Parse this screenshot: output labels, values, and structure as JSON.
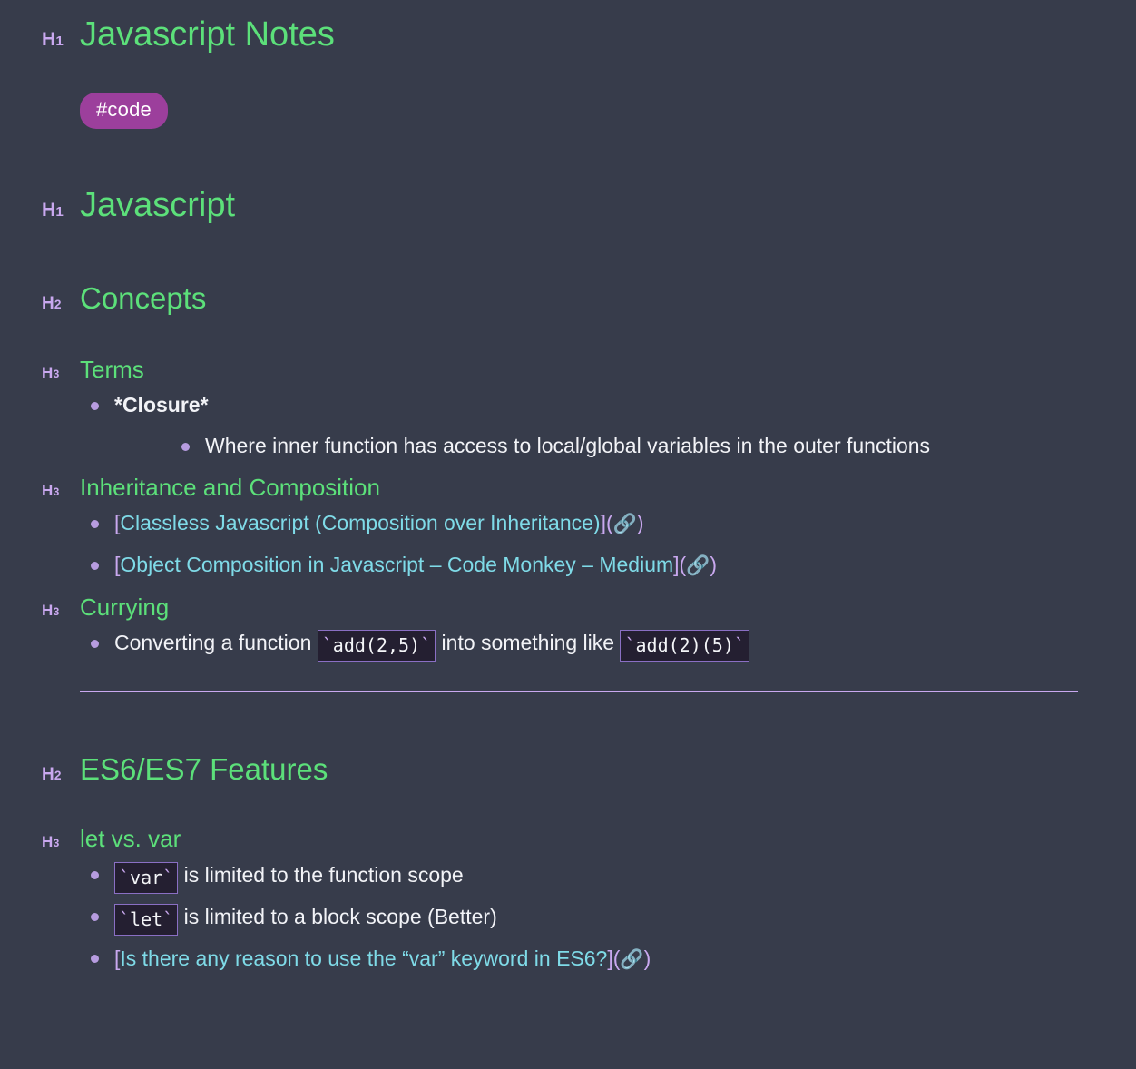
{
  "document": {
    "title": "Javascript Notes",
    "tag": "#code"
  },
  "markers": {
    "h1": "H",
    "h1_num": "1",
    "h2": "H",
    "h2_num": "2",
    "h3": "H",
    "h3_num": "3"
  },
  "colors": {
    "background": "#373c4b",
    "heading": "#5ce07a",
    "marker": "#c9a8ef",
    "link": "#7fdbe8",
    "bracket": "#c9a8ef",
    "bullet": "#b79ce0",
    "tag_bg": "#9c3f9c",
    "tag_text": "#ffffff",
    "body_text": "#f2f3f7",
    "code_bg": "#241f31",
    "code_border": "#8a6fc4",
    "rule": "#c9a8ef"
  },
  "sections": {
    "javascript": {
      "heading": "Javascript"
    },
    "concepts": {
      "heading": "Concepts"
    },
    "terms": {
      "heading": "Terms",
      "closure_label": "*Closure*",
      "closure_desc": "Where inner function has access to local/global variables in the outer functions"
    },
    "inheritance": {
      "heading": "Inheritance and Composition",
      "links": [
        {
          "open_bracket": "[",
          "text": "Classless Javascript (Composition over Inheritance)",
          "close_bracket": "](",
          "icon": "link-icon",
          "icon_glyph": "🔗",
          "close_paren": ")"
        },
        {
          "open_bracket": "[",
          "text": "Object Composition in Javascript – Code Monkey – Medium",
          "close_bracket": "](",
          "icon": "link-icon",
          "icon_glyph": "🔗",
          "close_paren": ")"
        }
      ]
    },
    "currying": {
      "heading": "Currying",
      "text_before": "Converting a function ",
      "code_a": "add(2,5)",
      "text_middle": " into something like ",
      "code_b": "add(2)(5)",
      "backtick": "`"
    },
    "es6": {
      "heading": "ES6/ES7 Features"
    },
    "let_vs_var": {
      "heading": "let vs. var",
      "items": [
        {
          "code": "var",
          "text": " is limited to the function scope"
        },
        {
          "code": "let",
          "text": " is limited to a block scope (Better)"
        }
      ],
      "link": {
        "open_bracket": "[",
        "text": "Is there any reason to use the “var” keyword in ES6?",
        "close_bracket": "](",
        "icon": "link-icon",
        "icon_glyph": "🔗",
        "close_paren": ")"
      }
    }
  }
}
